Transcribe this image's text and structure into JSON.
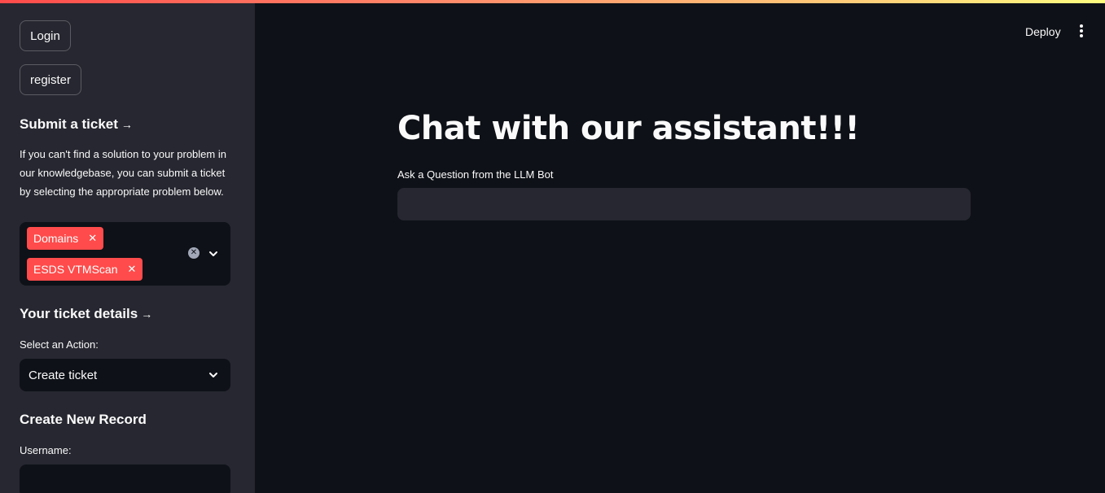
{
  "sidebar": {
    "login_label": "Login",
    "register_label": "register",
    "submit_heading": "Submit a ticket",
    "submit_text": "If you can't find a solution to your problem in our knowledgebase, you can submit a ticket by selecting the appropriate problem below.",
    "tags": [
      "Domains",
      "ESDS VTMScan"
    ],
    "ticket_heading": "Your ticket details",
    "action_label": "Select an Action:",
    "action_value": "Create ticket",
    "record_heading": "Create New Record",
    "username_label": "Username:"
  },
  "header": {
    "deploy_label": "Deploy",
    "menu_icon": "kebab-menu-icon"
  },
  "main": {
    "title": "Chat with our assistant!!!",
    "question_label": "Ask a Question from the LLM Bot",
    "question_value": ""
  },
  "colors": {
    "background": "#0e1117",
    "sidebar": "#262730",
    "accent": "#ff4b4b"
  }
}
